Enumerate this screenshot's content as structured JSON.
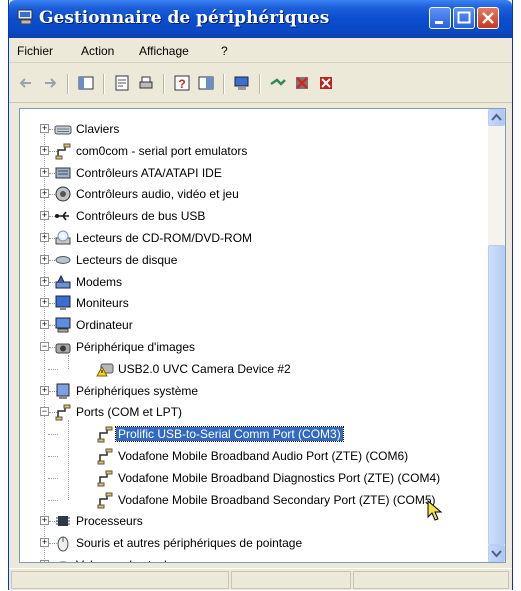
{
  "window": {
    "title": "Gestionnaire de périphériques"
  },
  "menu": {
    "items": [
      "Fichier",
      "Action",
      "Affichage",
      "?"
    ]
  },
  "tree": {
    "items": [
      {
        "label": "Claviers",
        "level": 1,
        "expander": "+",
        "icon": "keyboard-icon"
      },
      {
        "label": "com0com - serial port emulators",
        "level": 1,
        "expander": "+",
        "icon": "port-icon"
      },
      {
        "label": "Contrôleurs ATA/ATAPI IDE",
        "level": 1,
        "expander": "+",
        "icon": "ide-controller-icon"
      },
      {
        "label": "Contrôleurs audio, vidéo et jeu",
        "level": 1,
        "expander": "+",
        "icon": "audio-icon"
      },
      {
        "label": "Contrôleurs de bus USB",
        "level": 1,
        "expander": "+",
        "icon": "usb-icon"
      },
      {
        "label": "Lecteurs de CD-ROM/DVD-ROM",
        "level": 1,
        "expander": "+",
        "icon": "cdrom-icon"
      },
      {
        "label": "Lecteurs de disque",
        "level": 1,
        "expander": "+",
        "icon": "disk-icon"
      },
      {
        "label": "Modems",
        "level": 1,
        "expander": "+",
        "icon": "modem-icon"
      },
      {
        "label": "Moniteurs",
        "level": 1,
        "expander": "+",
        "icon": "monitor-icon"
      },
      {
        "label": "Ordinateur",
        "level": 1,
        "expander": "+",
        "icon": "computer-icon"
      },
      {
        "label": "Périphérique d'images",
        "level": 1,
        "expander": "−",
        "icon": "camera-icon"
      },
      {
        "label": "USB2.0 UVC Camera Device #2",
        "level": 2,
        "expander": "",
        "icon": "warning-camera-icon"
      },
      {
        "label": "Périphériques système",
        "level": 1,
        "expander": "+",
        "icon": "system-icon"
      },
      {
        "label": "Ports (COM et LPT)",
        "level": 1,
        "expander": "−",
        "icon": "port-icon"
      },
      {
        "label": "Prolific USB-to-Serial Comm Port (COM3)",
        "level": 2,
        "expander": "",
        "icon": "port-icon",
        "selected": true
      },
      {
        "label": "Vodafone Mobile Broadband Audio Port (ZTE) (COM6)",
        "level": 2,
        "expander": "",
        "icon": "port-icon"
      },
      {
        "label": "Vodafone Mobile Broadband Diagnostics Port (ZTE) (COM4)",
        "level": 2,
        "expander": "",
        "icon": "port-icon"
      },
      {
        "label": "Vodafone Mobile Broadband Secondary Port (ZTE) (COM5)",
        "level": 2,
        "expander": "",
        "icon": "port-icon"
      },
      {
        "label": "Processeurs",
        "level": 1,
        "expander": "+",
        "icon": "processor-icon"
      },
      {
        "label": "Souris et autres périphériques de pointage",
        "level": 1,
        "expander": "+",
        "icon": "mouse-icon"
      },
      {
        "label": "Volumes de stockage",
        "level": 1,
        "expander": "+",
        "icon": "storage-icon"
      }
    ]
  },
  "colors": {
    "selection": "#316ac5",
    "titlebar": "#0a4ed0"
  }
}
